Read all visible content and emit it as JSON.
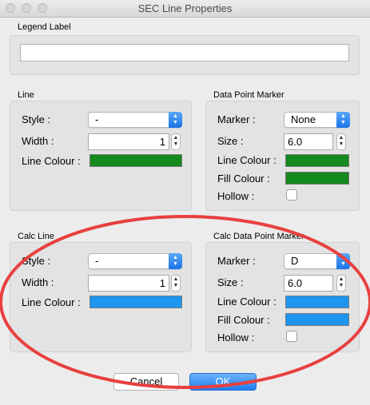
{
  "window": {
    "title": "SEC Line Properties"
  },
  "legend": {
    "label": "Legend Label",
    "value": ""
  },
  "line": {
    "group_label": "Line",
    "style_label": "Style :",
    "style_value": "-",
    "width_label": "Width :",
    "width_value": "1",
    "colour_label": "Line Colour :",
    "colour": "#14891e"
  },
  "marker": {
    "group_label": "Data Point Marker",
    "marker_label": "Marker :",
    "marker_value": "None",
    "size_label": "Size :",
    "size_value": "6.0",
    "line_colour_label": "Line Colour :",
    "line_colour": "#14891e",
    "fill_colour_label": "Fill Colour :",
    "fill_colour": "#14891e",
    "hollow_label": "Hollow :"
  },
  "calc_line": {
    "group_label": "Calc Line",
    "style_label": "Style :",
    "style_value": "-",
    "width_label": "Width :",
    "width_value": "1",
    "colour_label": "Line Colour :",
    "colour": "#1e96f0"
  },
  "calc_marker": {
    "group_label": "Calc Data Point Marker",
    "marker_label": "Marker :",
    "marker_value": "D",
    "size_label": "Size :",
    "size_value": "6.0",
    "line_colour_label": "Line Colour :",
    "line_colour": "#1e96f0",
    "fill_colour_label": "Fill Colour :",
    "fill_colour": "#1e96f0",
    "hollow_label": "Hollow :"
  },
  "buttons": {
    "cancel": "Cancel",
    "ok": "OK"
  },
  "annotation": {
    "color": "#e8403f"
  }
}
